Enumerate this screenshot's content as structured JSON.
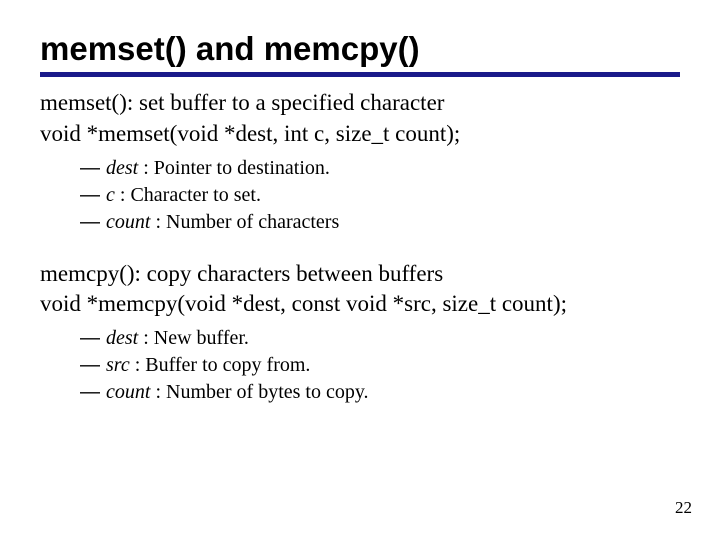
{
  "title": "memset() and memcpy()",
  "memset": {
    "desc": "memset(): set buffer to a specified character",
    "signature": "void *memset(void *dest, int c, size_t count);",
    "params": [
      {
        "name": "dest ",
        "desc": ": Pointer to destination."
      },
      {
        "name": "c ",
        "desc": ": Character to set."
      },
      {
        "name": "count ",
        "desc": ": Number of characters"
      }
    ]
  },
  "memcpy": {
    "desc": "memcpy(): copy characters between buffers",
    "signature": "void *memcpy(void *dest, const void *src, size_t count);",
    "params": [
      {
        "name": "dest ",
        "desc": ": New buffer."
      },
      {
        "name": "src ",
        "desc": ": Buffer to copy from."
      },
      {
        "name": "count ",
        "desc": ": Number of bytes to copy."
      }
    ]
  },
  "page_number": "22",
  "dash_glyph": "—"
}
